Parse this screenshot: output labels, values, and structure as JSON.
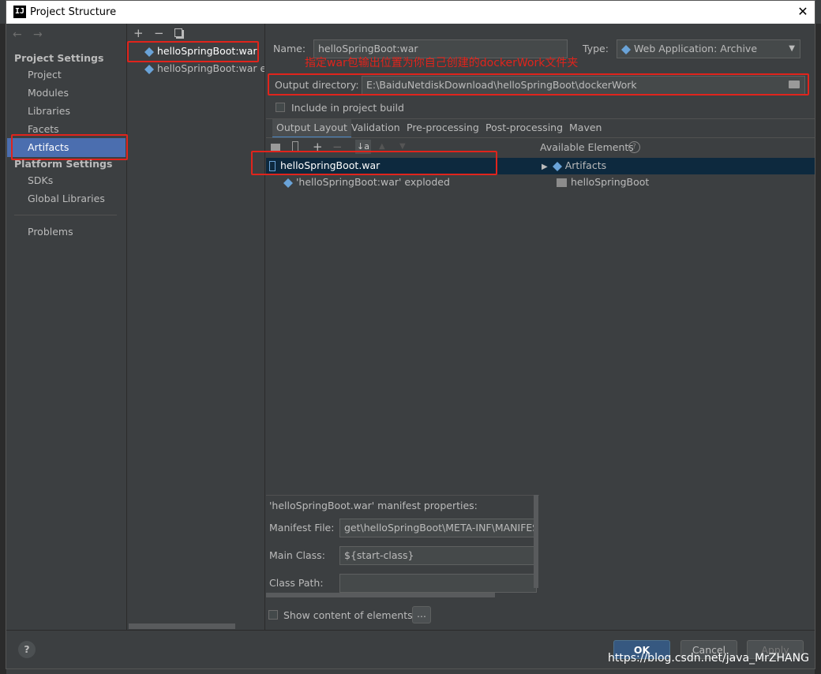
{
  "window": {
    "title": "Project Structure",
    "app_icon_text": "IJ"
  },
  "nav": {
    "project_settings_header": "Project Settings",
    "project_settings_items": [
      "Project",
      "Modules",
      "Libraries",
      "Facets",
      "Artifacts"
    ],
    "selected": "Artifacts",
    "platform_settings_header": "Platform Settings",
    "platform_settings_items": [
      "SDKs",
      "Global Libraries"
    ],
    "problems": "Problems"
  },
  "artifacts_list": [
    "helloSpringBoot:war",
    "helloSpringBoot:war exploded"
  ],
  "form": {
    "name_label": "Name:",
    "name_value": "helloSpringBoot:war",
    "type_label": "Type:",
    "type_value": "Web Application: Archive",
    "output_dir_label": "Output directory:",
    "output_dir_value": "E:\\BaiduNetdiskDownload\\helloSpringBoot\\dockerWork",
    "include_in_build_label": "Include in project build",
    "include_in_build_checked": false
  },
  "annotation": "指定war包输出位置为你自己创建的dockerWork文件夹",
  "tabs": [
    "Output Layout",
    "Validation",
    "Pre-processing",
    "Post-processing",
    "Maven"
  ],
  "active_tab": "Output Layout",
  "layout_tree": [
    "helloSpringBoot.war",
    "'helloSpringBoot:war' exploded"
  ],
  "available": {
    "header": "Available Elements",
    "items": [
      "Artifacts",
      "helloSpringBoot"
    ]
  },
  "manifest": {
    "title": "'helloSpringBoot.war' manifest properties:",
    "file_label": "Manifest File:",
    "file_value": "get\\helloSpringBoot\\META-INF\\MANIFEST.",
    "main_class_label": "Main Class:",
    "main_class_value": "${start-class}",
    "class_path_label": "Class Path:",
    "class_path_value": ""
  },
  "show_content_label": "Show content of elements",
  "ellipsis_label": "...",
  "buttons": {
    "ok": "OK",
    "cancel": "Cancel",
    "apply": "Apply",
    "help": "?"
  },
  "watermark": "https://blog.csdn.net/java_MrZHANG",
  "colors": {
    "accent": "#4b6eaf",
    "annotation_red": "#e0241c",
    "selection": "#0d293e"
  }
}
